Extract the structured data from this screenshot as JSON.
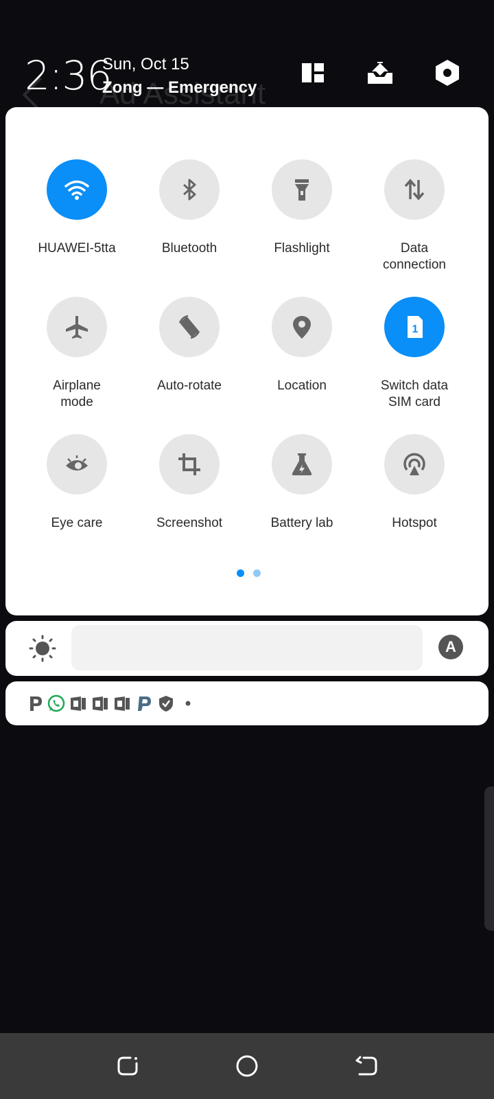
{
  "background_app": {
    "title": "Ad Assistant"
  },
  "header": {
    "time": "2:36",
    "date": "Sun, Oct 15",
    "carrier": "Zong — Emergency",
    "icons": [
      "grid-edit-icon",
      "tray-download-icon",
      "settings-gear-icon"
    ]
  },
  "tiles": [
    {
      "label": "HUAWEI-5tta",
      "icon": "wifi-icon",
      "active": true
    },
    {
      "label": "Bluetooth",
      "icon": "bluetooth-icon",
      "active": false
    },
    {
      "label": "Flashlight",
      "icon": "flashlight-icon",
      "active": false
    },
    {
      "label": "Data\nconnection",
      "icon": "data-arrows-icon",
      "active": false
    },
    {
      "label": "Airplane\nmode",
      "icon": "airplane-icon",
      "active": false
    },
    {
      "label": "Auto-rotate",
      "icon": "auto-rotate-icon",
      "active": false
    },
    {
      "label": "Location",
      "icon": "location-pin-icon",
      "active": false
    },
    {
      "label": "Switch data\nSIM card",
      "icon": "sim-card-icon",
      "active": true,
      "sim_number": "1"
    },
    {
      "label": "Eye care",
      "icon": "eye-care-icon",
      "active": false
    },
    {
      "label": "Screenshot",
      "icon": "crop-icon",
      "active": false
    },
    {
      "label": "Battery lab",
      "icon": "flask-icon",
      "active": false
    },
    {
      "label": "Hotspot",
      "icon": "hotspot-icon",
      "active": false
    }
  ],
  "pager": {
    "pages": 2,
    "current": 1
  },
  "brightness": {
    "auto_label": "A"
  },
  "notifications": {
    "icons": [
      "p-app-icon",
      "whatsapp-icon",
      "calendar-icon",
      "calendar-icon",
      "calendar-icon",
      "p-app-icon",
      "shield-check-icon",
      "more-dot-icon"
    ]
  },
  "colors": {
    "accent": "#0a8ef7",
    "tile_bg": "#e6e6e6",
    "whatsapp": "#1fa855"
  }
}
